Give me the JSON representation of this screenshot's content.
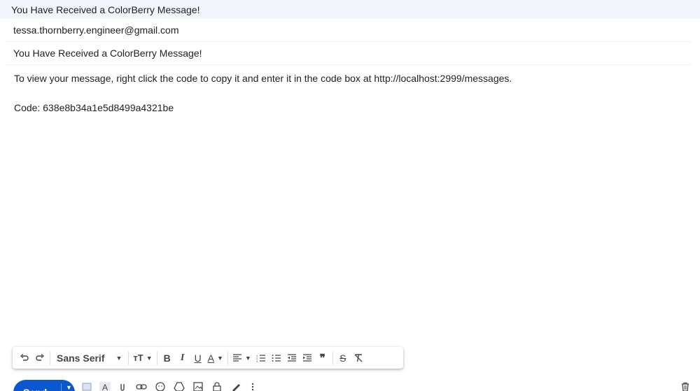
{
  "window": {
    "title": "You Have Received a ColorBerry Message!"
  },
  "compose": {
    "to": "tessa.thornberry.engineer@gmail.com",
    "subject": "You Have Received a ColorBerry Message!",
    "body_line1": "To view your message, right click the code to copy it and enter it in the code box at http://localhost:2999/messages.",
    "body_line2": "Code: 638e8b34a1e5d8499a4321be"
  },
  "toolbar": {
    "font": "Sans Serif",
    "bold": "B",
    "italic": "I",
    "underline": "U",
    "text_color": "A",
    "icons": [
      "undo-icon",
      "redo-icon",
      "text-size-icon",
      "align-icon",
      "numbered-list-icon",
      "bulleted-list-icon",
      "indent-less-icon",
      "indent-more-icon",
      "quote-icon",
      "strikethrough-icon",
      "remove-formatting-icon"
    ]
  },
  "bottom": {
    "send": "Send",
    "format_icon_letter": "A",
    "icons": [
      "formatting-toggle-icon",
      "attach-icon",
      "link-icon",
      "emoji-icon",
      "drive-icon",
      "photo-icon",
      "confidential-icon",
      "signature-icon",
      "more-options-icon",
      "trash-icon"
    ]
  },
  "colors": {
    "accent": "#0b57d0",
    "titlebar_bg": "#f2f6fc"
  }
}
